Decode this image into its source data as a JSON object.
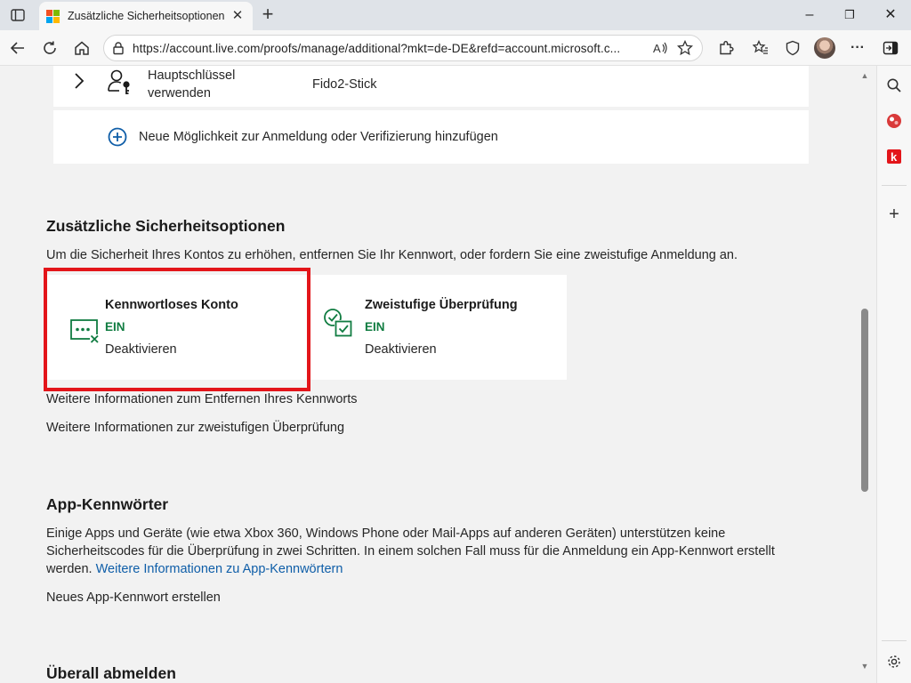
{
  "browser": {
    "tab": {
      "title": "Zusätzliche Sicherheitsoptionen"
    },
    "address_url": "https://account.live.com/proofs/manage/additional?mkt=de-DE&refd=account.microsoft.c..."
  },
  "page": {
    "passkey_row": {
      "title_line1": "Hauptschlüssel",
      "title_line2": "verwenden",
      "value": "Fido2-Stick"
    },
    "add_method_link": "Neue Möglichkeit zur Anmeldung oder Verifizierung hinzufügen",
    "additional_security": {
      "heading": "Zusätzliche Sicherheitsoptionen",
      "description": "Um die Sicherheit Ihres Kontos zu erhöhen, entfernen Sie Ihr Kennwort, oder fordern Sie eine zweistufige Anmeldung an.",
      "options": [
        {
          "title": "Kennwortloses Konto",
          "status": "EIN",
          "action": "Deaktivieren",
          "icon": "passwordless-icon"
        },
        {
          "title": "Zweistufige Überprüfung",
          "status": "EIN",
          "action": "Deaktivieren",
          "icon": "two-step-verification-icon"
        }
      ],
      "link_passwordless_info": "Weitere Informationen zum Entfernen Ihres Kennworts",
      "link_twostep_info": "Weitere Informationen zur zweistufigen Überprüfung"
    },
    "app_passwords": {
      "heading": "App-Kennwörter",
      "description_line1": "Einige Apps und Geräte (wie etwa Xbox 360, Windows Phone oder Mail-Apps auf anderen Geräten) unterstützen keine",
      "description_line2": "Sicherheitscodes für die Überprüfung in zwei Schritten. In einem solchen Fall muss für die Anmeldung ein App-Kennwort erstellt",
      "description_line3_prefix": "werden.",
      "learn_more_link": "Weitere Informationen zu App-Kennwörtern",
      "create_link": "Neues App-Kennwort erstellen"
    },
    "signout_everywhere": {
      "heading": "Überall abmelden"
    }
  },
  "colors": {
    "link": "#0f5ea8",
    "status_on": "#107c41",
    "highlight_border": "#e3151a",
    "icon_green": "#107c41"
  }
}
